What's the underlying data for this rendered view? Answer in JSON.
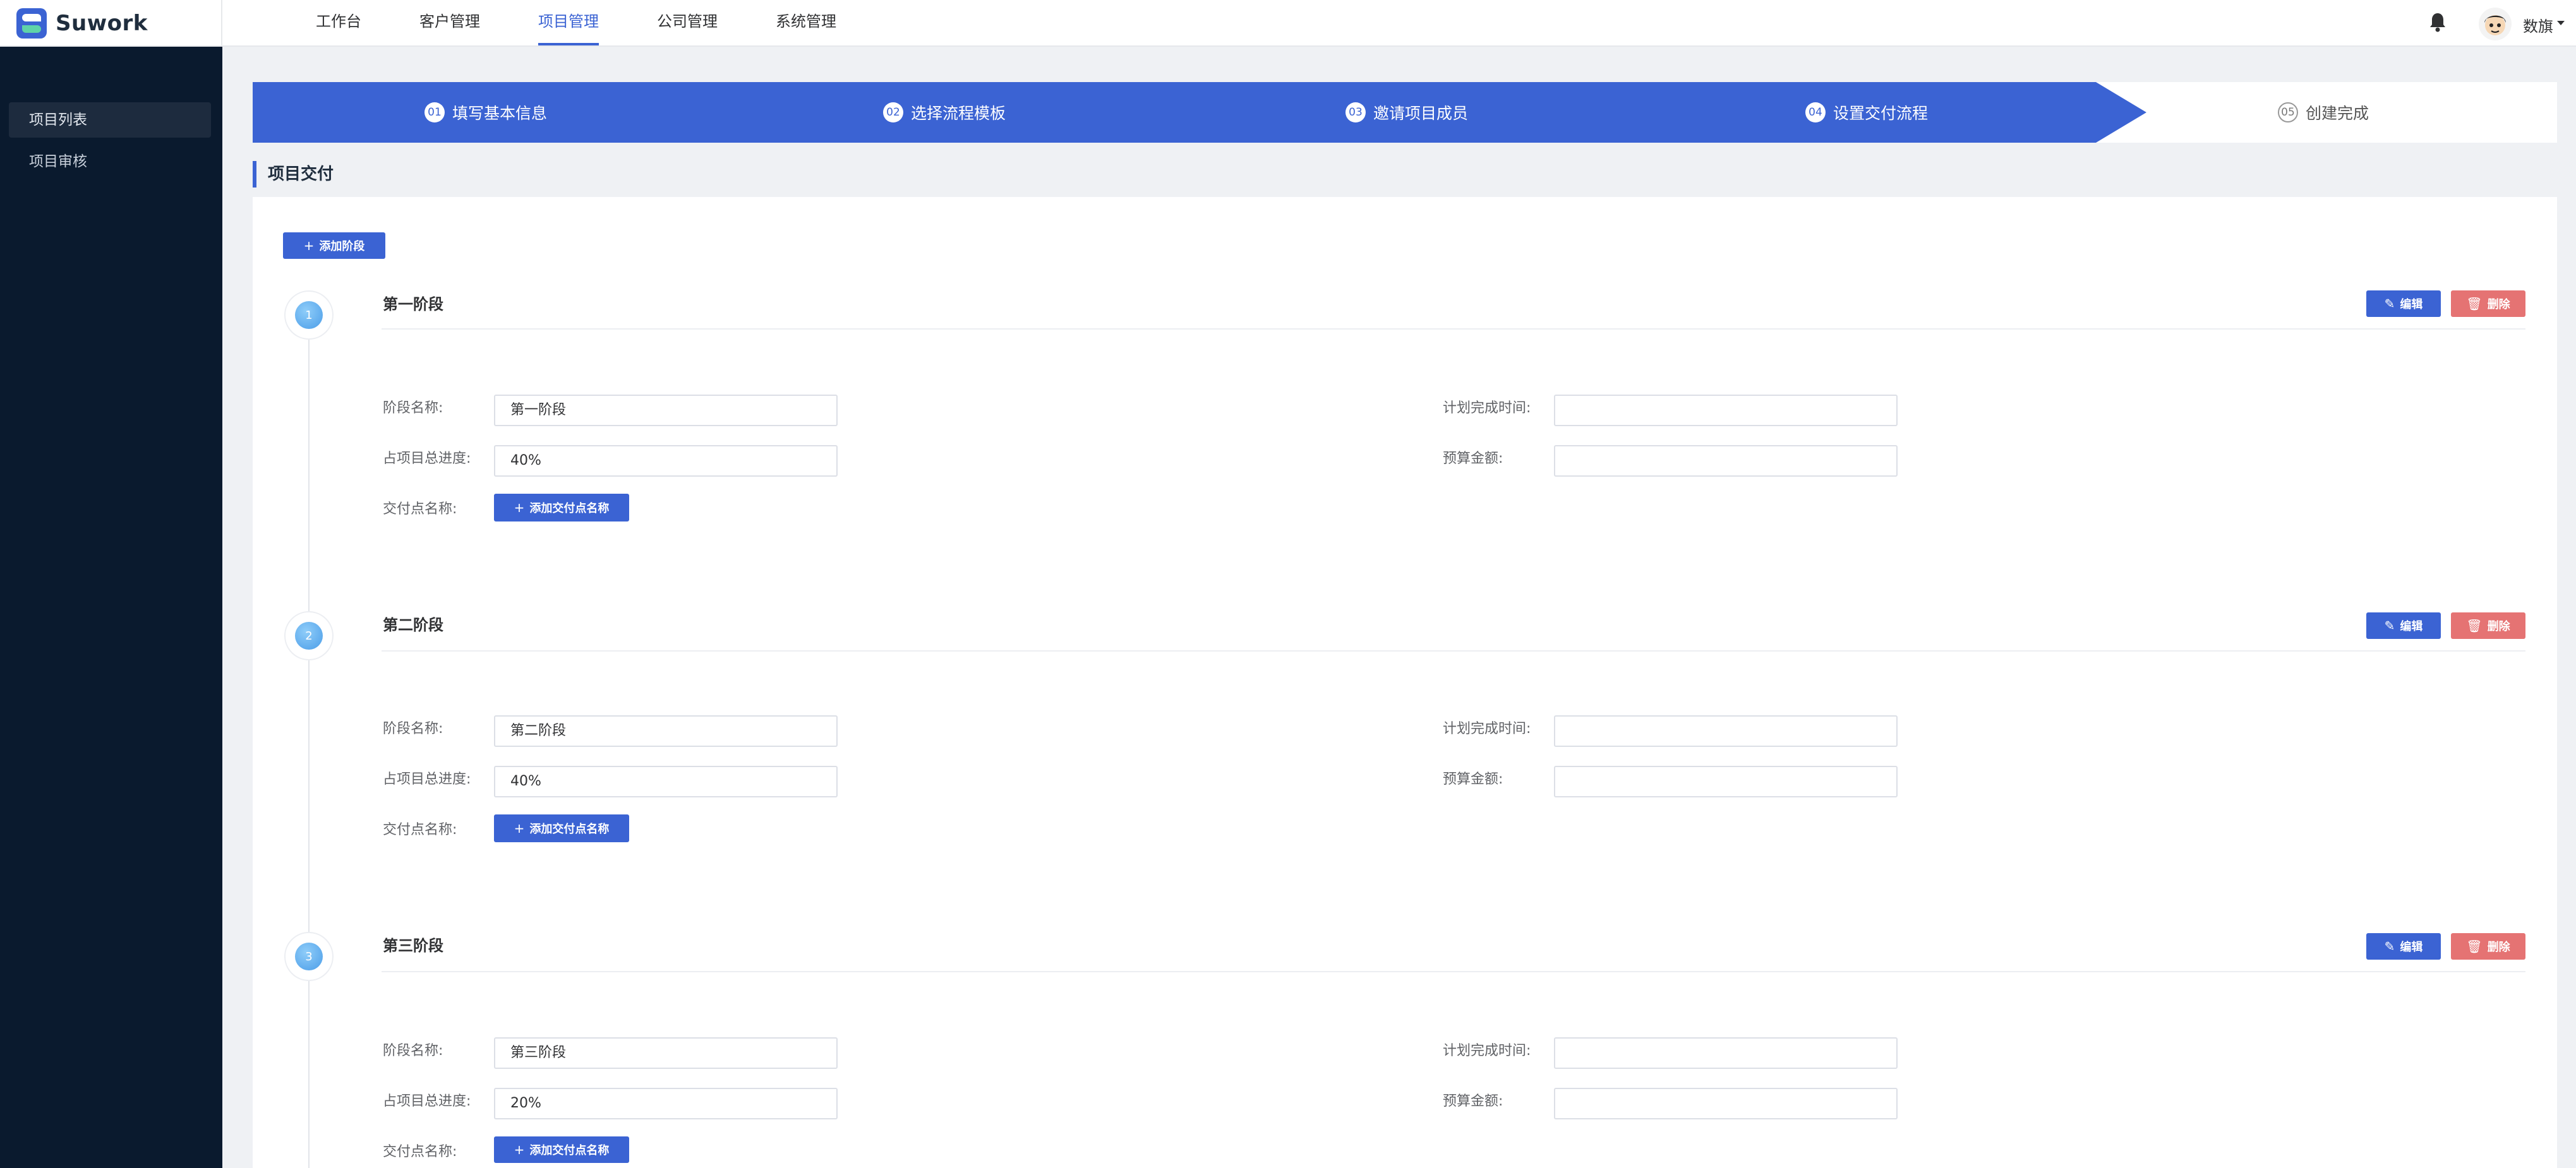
{
  "app": {
    "name": "Suwork"
  },
  "nav": {
    "items": [
      "工作台",
      "客户管理",
      "项目管理",
      "公司管理",
      "系统管理"
    ],
    "active_index": 2
  },
  "user": {
    "name": "数旗"
  },
  "sidebar": {
    "items": [
      "项目列表",
      "项目审核"
    ],
    "active_index": 0
  },
  "steps": [
    {
      "num": "01",
      "label": "填写基本信息"
    },
    {
      "num": "02",
      "label": "选择流程模板"
    },
    {
      "num": "03",
      "label": "邀请项目成员"
    },
    {
      "num": "04",
      "label": "设置交付流程"
    },
    {
      "num": "05",
      "label": "创建完成"
    }
  ],
  "section": {
    "title": "项目交付"
  },
  "add_stage_label": "添加阶段",
  "edit_label": "编辑",
  "delete_label": "删除",
  "field_labels": {
    "stage_name": "阶段名称:",
    "progress": "占项目总进度:",
    "delivery_point": "交付点名称:",
    "planned_time": "计划完成时间:",
    "budget": "预算金额:"
  },
  "add_delivery_label": "添加交付点名称",
  "stages": [
    {
      "num": "1",
      "title": "第一阶段",
      "name_value": "第一阶段",
      "progress_value": "40%",
      "planned_time_value": "",
      "budget_value": ""
    },
    {
      "num": "2",
      "title": "第二阶段",
      "name_value": "第二阶段",
      "progress_value": "40%",
      "planned_time_value": "",
      "budget_value": ""
    },
    {
      "num": "3",
      "title": "第三阶段",
      "name_value": "第三阶段",
      "progress_value": "20%",
      "planned_time_value": "",
      "budget_value": ""
    }
  ],
  "colors": {
    "primary": "#3b63d3",
    "danger": "#e57373",
    "sidebar_bg": "#0a1a2e",
    "page_bg": "#eff1f4"
  }
}
